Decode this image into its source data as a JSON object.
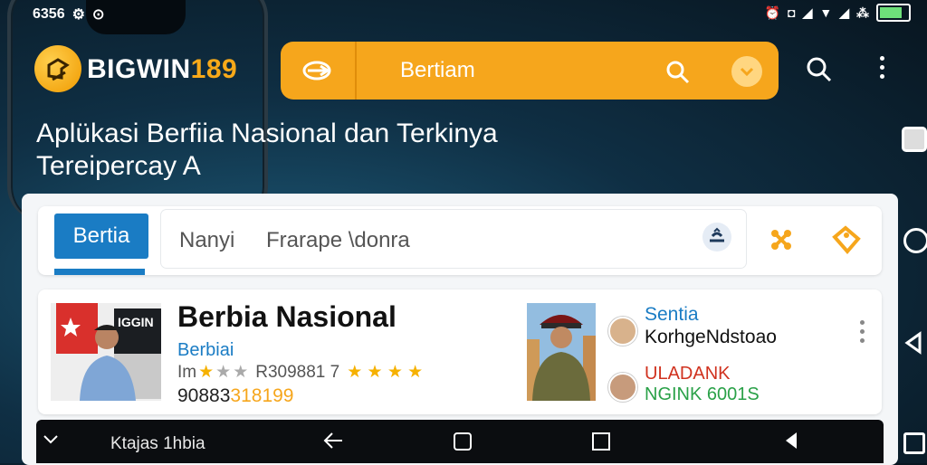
{
  "status_bar": {
    "time": "6356",
    "right_icons": [
      "alarm-icon",
      "vibrate-icon",
      "signal-icon",
      "wifi-icon",
      "signal-icon",
      "data-icon",
      "battery-icon"
    ]
  },
  "brand": {
    "name_main": "BIGWIN",
    "name_num": "189"
  },
  "top_search": {
    "label": "Bertiam"
  },
  "headline": "Aplükasi Berfiia Nasional dan Terkinya Tereipercay A",
  "search": {
    "tab_label": "Bertia",
    "input_text_1": "Nanyi",
    "input_text_2": "Frarape \\donra"
  },
  "news": {
    "title": "Berbia Nasional",
    "subtitle": "Berbiai",
    "rating_prefix": "Im",
    "rating_code": "R309881 7",
    "number_dark": "90883",
    "number_highlight": "318199",
    "right_line_1": "Sentia",
    "right_line_2": "KorhgeNdstoao",
    "right_line_3": "ULADANK",
    "right_line_4": "NGINK 6001S"
  },
  "bottom_nav": {
    "label": "Ktajas 1hbia"
  },
  "colors": {
    "accent_orange": "#f6a61c",
    "primary_blue": "#1a7cc4",
    "dark_bg": "#0f2f44"
  }
}
